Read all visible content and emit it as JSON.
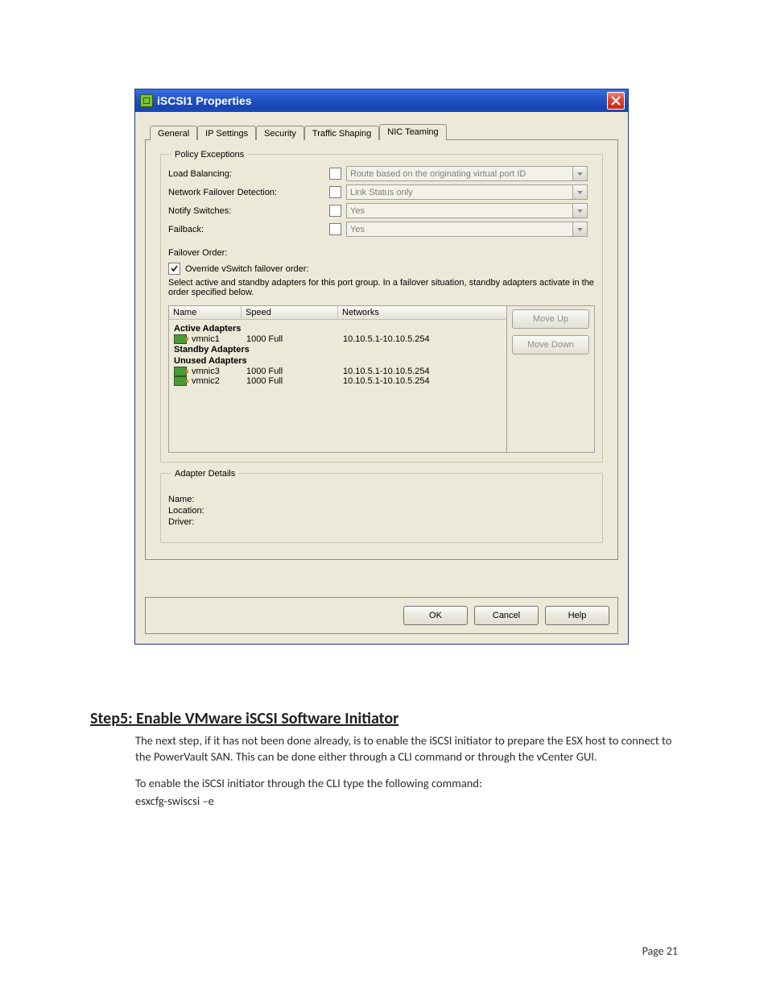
{
  "window": {
    "title": "iSCSI1 Properties"
  },
  "tabs": {
    "t0": "General",
    "t1": "IP Settings",
    "t2": "Security",
    "t3": "Traffic Shaping",
    "t4": "NIC Teaming"
  },
  "policy": {
    "group_title": "Policy Exceptions",
    "rows": {
      "load_balancing": {
        "label": "Load Balancing:",
        "value": "Route based on the originating virtual port ID"
      },
      "failover_detection": {
        "label": "Network Failover Detection:",
        "value": "Link Status only"
      },
      "notify_switches": {
        "label": "Notify Switches:",
        "value": "Yes"
      },
      "failback": {
        "label": "Failback:",
        "value": "Yes"
      }
    }
  },
  "failover": {
    "title": "Failover Order:",
    "override_label": "Override vSwitch failover order:",
    "description": "Select active and standby adapters for this port group.  In a failover situation, standby adapters activate  in the order specified below.",
    "columns": {
      "name": "Name",
      "speed": "Speed",
      "networks": "Networks"
    },
    "groups": {
      "active": "Active Adapters",
      "standby": "Standby Adapters",
      "unused": "Unused Adapters"
    },
    "adapters": {
      "a1": {
        "name": "vmnic1",
        "speed": "1000 Full",
        "networks": "10.10.5.1-10.10.5.254"
      },
      "a3": {
        "name": "vmnic3",
        "speed": "1000 Full",
        "networks": "10.10.5.1-10.10.5.254"
      },
      "a2": {
        "name": "vmnic2",
        "speed": "1000 Full",
        "networks": "10.10.5.1-10.10.5.254"
      }
    },
    "buttons": {
      "up": "Move Up",
      "down": "Move Down"
    }
  },
  "details": {
    "group_title": "Adapter Details",
    "name_label": "Name:",
    "location_label": "Location:",
    "driver_label": "Driver:"
  },
  "buttons": {
    "ok": "OK",
    "cancel": "Cancel",
    "help": "Help"
  },
  "doc": {
    "heading": "Step5: Enable VMware iSCSI Software Initiator",
    "para1": "The next step, if it has not been done already, is to enable the iSCSI initiator to prepare the ESX host to connect to the PowerVault SAN. This can be done either through a CLI command or through the vCenter GUI.",
    "para2": "To enable the iSCSI initiator through the CLI type the following command:",
    "cmd": "esxcfg-swiscsi –e",
    "pagenum": "Page 21"
  }
}
